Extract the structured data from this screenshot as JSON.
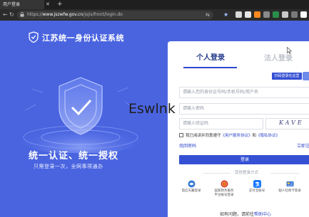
{
  "browser": {
    "tab_title": "用户登录",
    "url_scheme": "https://",
    "url_host": "www.jszwfw.gov.cn",
    "url_path": "/jsjis/front/login.do"
  },
  "hero": {
    "title": "江苏统一身份认证系统",
    "slogan": "统一认证、统一授权",
    "sub_slogan": "只需登录一次，全网事项通办"
  },
  "login": {
    "tab_personal": "个人登录",
    "tab_legal": "法人登录",
    "qr_button": "扫码登录在这里",
    "fields": {
      "account_placeholder": "请输入您的身份证号码/手机号码/用户名",
      "password_placeholder": "请输入密码",
      "captcha_placeholder": "请输入验证码"
    },
    "captcha_text": "KAVE",
    "agreement": {
      "prefix": "我已阅读并同意遵守",
      "user_agreement": "《用户服务协议》",
      "and": "和",
      "privacy": "《隐私协议》"
    },
    "forgot": "找回密码",
    "register": "立即注册",
    "submit": "登录",
    "other_methods_title": "其他登录方式",
    "alt_methods": [
      {
        "label_line1": "电信天翼登录",
        "label_line2": "",
        "color": "#3a7bd5",
        "icon": "tianyi-icon"
      },
      {
        "label_line1": "国家政务服务",
        "label_line2": "平台账号登录",
        "color": "#d8342b",
        "icon": "national-emblem-icon"
      },
      {
        "label_line1": "支付宝账号",
        "label_line2": "",
        "color": "#1677ff",
        "icon": "alipay-icon"
      },
      {
        "label_line1": "個人社保卡登录",
        "label_line2": "",
        "color": "#2e6fd8",
        "icon": "social-security-card-icon"
      }
    ],
    "help": {
      "prefix": "如有问题，请前往",
      "link": "帮助中心"
    }
  },
  "watermark": "Eswlnk",
  "colors": {
    "background": "#4a64e0",
    "primary": "#3550d3",
    "link": "#2e47c9"
  }
}
